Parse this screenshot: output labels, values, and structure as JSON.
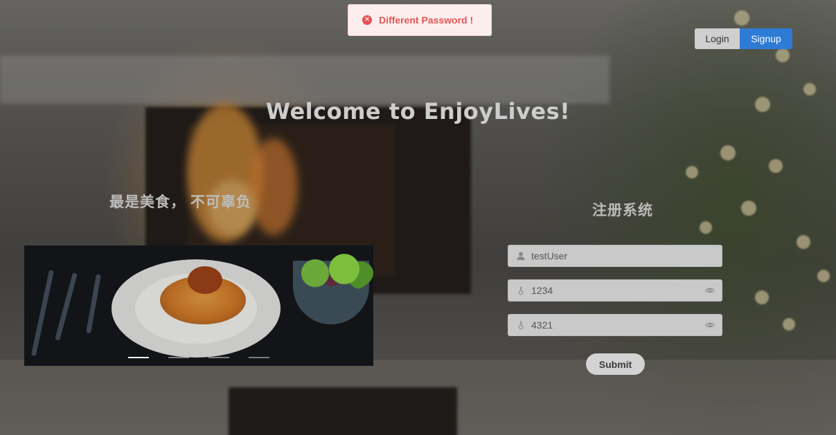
{
  "toast": {
    "message": "Different Password !",
    "icon": "error-circle-icon",
    "color": "#e35454"
  },
  "header": {
    "login_label": "Login",
    "signup_label": "Signup",
    "accent": "#2e7bd6"
  },
  "hero": {
    "welcome": "Welcome to EnjoyLives!",
    "slogan": "最是美食， 不可辜负"
  },
  "carousel": {
    "slides": 4,
    "active_index": 0
  },
  "register": {
    "title": "注册系统",
    "username": {
      "value": "testUser",
      "icon": "user-icon"
    },
    "password": {
      "value": "1234",
      "icon": "key-icon"
    },
    "confirm_password": {
      "value": "4321",
      "icon": "key-icon"
    },
    "submit_label": "Submit"
  }
}
